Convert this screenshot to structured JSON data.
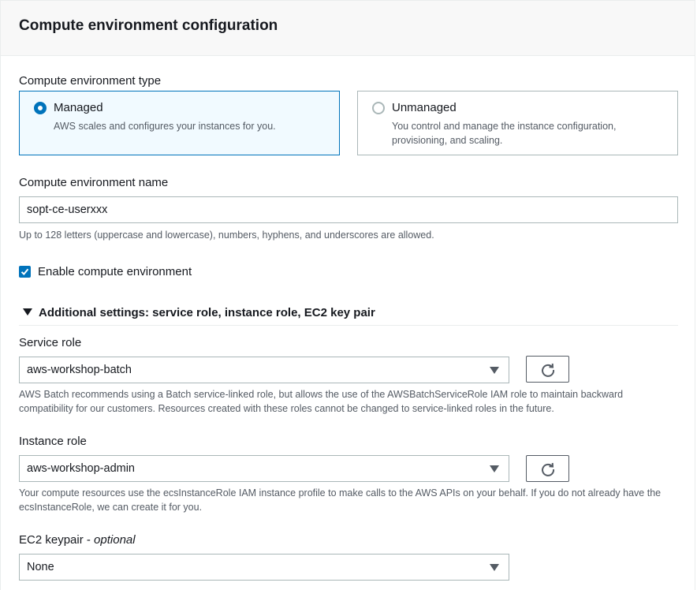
{
  "header": {
    "title": "Compute environment configuration"
  },
  "type_section": {
    "label": "Compute environment type",
    "options": [
      {
        "title": "Managed",
        "desc": "AWS scales and configures your instances for you.",
        "selected": true
      },
      {
        "title": "Unmanaged",
        "desc": "You control and manage the instance configuration, provisioning, and scaling.",
        "selected": false
      }
    ]
  },
  "name_field": {
    "label": "Compute environment name",
    "value": "sopt-ce-userxxx",
    "hint": "Up to 128 letters (uppercase and lowercase), numbers, hyphens, and underscores are allowed."
  },
  "enable": {
    "label": "Enable compute environment",
    "checked": true
  },
  "additional": {
    "label": "Additional settings: service role, instance role, EC2 key pair",
    "expanded": true
  },
  "service_role": {
    "label": "Service role",
    "value": "aws-workshop-batch",
    "hint": "AWS Batch recommends using a Batch service-linked role, but allows the use of the AWSBatchServiceRole IAM role to maintain backward compatibility for our customers. Resources created with these roles cannot be changed to service-linked roles in the future."
  },
  "instance_role": {
    "label": "Instance role",
    "value": "aws-workshop-admin",
    "hint": "Your compute resources use the ecsInstanceRole IAM instance profile to make calls to the AWS APIs on your behalf. If you do not already have the ecsInstanceRole, we can create it for you."
  },
  "keypair": {
    "label": "EC2 keypair",
    "optional": "optional",
    "value": "None"
  },
  "colors": {
    "accent": "#0073bb",
    "selected_bg": "#f1faff",
    "border": "#aab7b8",
    "hint_text": "#545b64"
  }
}
